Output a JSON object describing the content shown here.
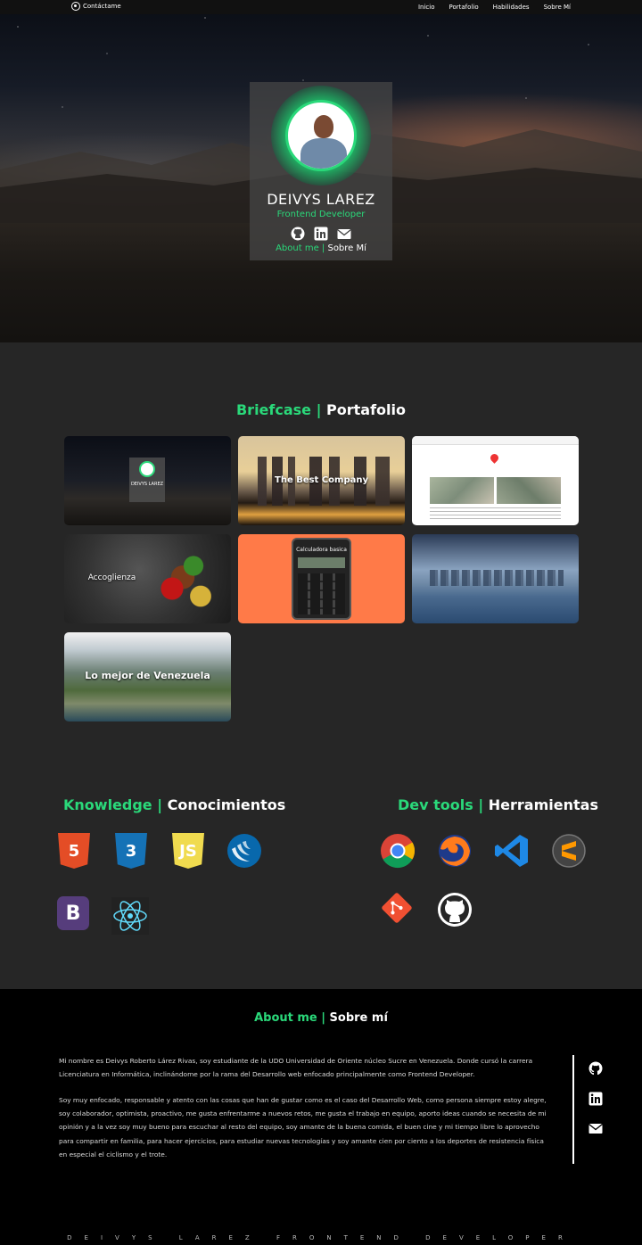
{
  "nav": {
    "contact_label": "Contáctame",
    "links": [
      "Inicio",
      "Portafolio",
      "Habilidades",
      "Sobre Mí"
    ]
  },
  "profile": {
    "name": "DEIVYS LAREZ",
    "role": "Frontend Developer",
    "about_en": "About me",
    "separator": "|",
    "about_es": "Sobre Mí"
  },
  "portfolio": {
    "title_en": "Briefcase",
    "separator": "|",
    "title_es": "Portafolio",
    "cards": [
      {
        "mini_name": "DEIVYS LAREZ"
      },
      {
        "title": "The Best Company"
      },
      {
        "title": ""
      },
      {
        "title": "Accoglienza"
      },
      {
        "title": "Calculadora basica"
      },
      {
        "title": ""
      },
      {
        "title": "Lo mejor de Venezuela"
      }
    ]
  },
  "knowledge": {
    "title_en": "Knowledge",
    "separator": "|",
    "title_es": "Conocimientos",
    "items": [
      "HTML5",
      "CSS3",
      "JS",
      "jQuery",
      "B",
      "React"
    ]
  },
  "tools": {
    "title_en": "Dev tools",
    "separator": "|",
    "title_es": "Herramientas",
    "items": [
      "Chrome",
      "Firefox",
      "VS Code",
      "Sublime",
      "Git",
      "GitHub"
    ]
  },
  "about": {
    "title_en": "About me",
    "separator": "|",
    "title_es": "Sobre mí",
    "paragraph1": "Mi nombre es Deivys Roberto Lárez Rivas, soy estudiante de la UDO Universidad de Oriente núcleo Sucre en Venezuela. Donde cursó la carrera Licenciatura en Informática, inclinándome por la rama del Desarrollo web enfocado principalmente como Frontend Developer.",
    "paragraph2": "Soy muy enfocado, responsable y atento con las cosas que han de gustar como es el caso del Desarrollo Web, como persona siempre estoy alegre, soy colaborador, optimista, proactivo, me gusta enfrentarme a nuevos retos, me gusta el trabajo en equipo, aporto ideas cuando se necesita de mi opinión y a la vez soy muy bueno para escuchar al resto del equipo, soy amante de la buena comida, el buen cine y mi tiempo libre lo aprovecho para compartir en familia, para hacer ejercicios, para estudiar nuevas tecnologías y soy amante cien por ciento a los deportes de resistencia física en especial el ciclismo y el trote.",
    "signature": "DEIVYS LAREZ FRONTEND DEVELOPER"
  },
  "colors": {
    "accent": "#2ad97a",
    "background": "#262626",
    "footer": "#000000"
  },
  "icons": [
    "whatsapp-icon",
    "github-icon",
    "linkedin-icon",
    "envelope-icon"
  ]
}
